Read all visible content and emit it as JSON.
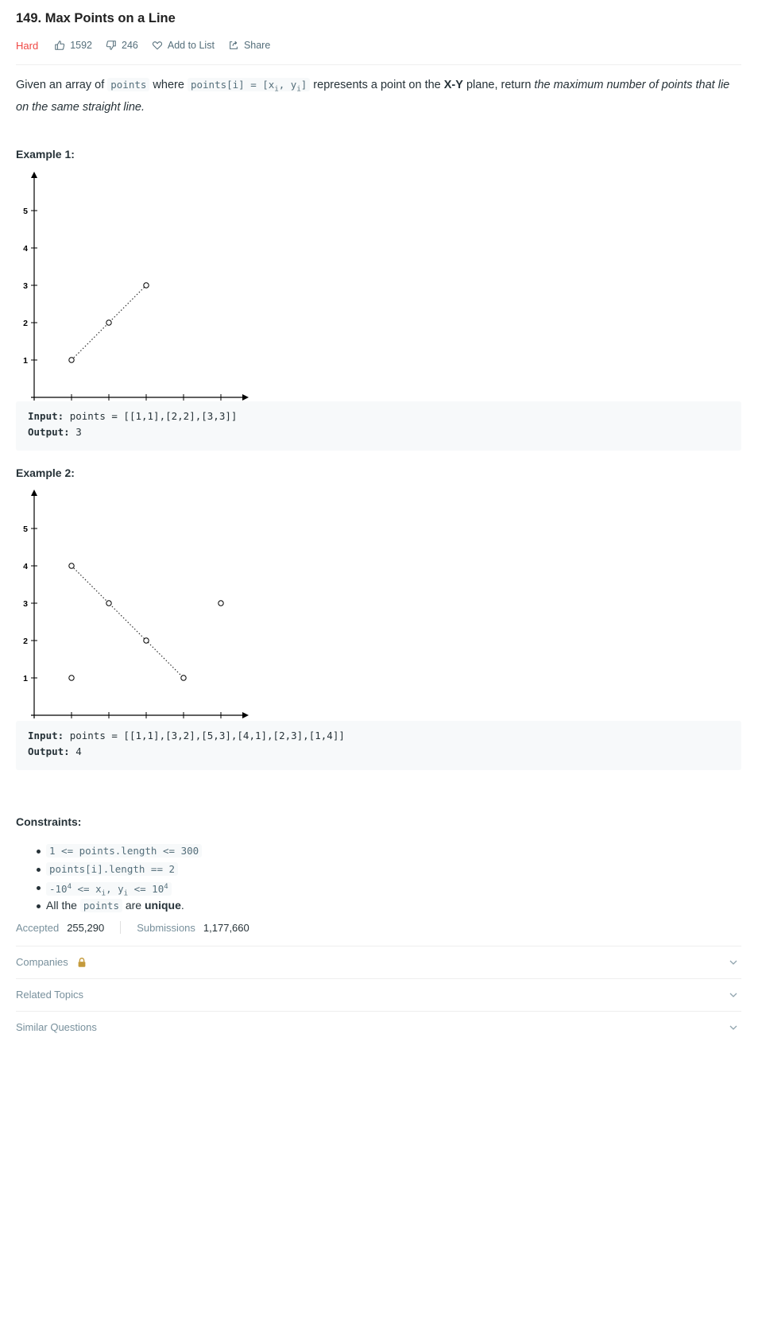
{
  "problem": {
    "title": "149. Max Points on a Line",
    "difficulty": "Hard",
    "likes": "1592",
    "dislikes": "246",
    "add_to_list_label": "Add to List",
    "share_label": "Share"
  },
  "description": {
    "p1": "Given an array of ",
    "code_points": "points",
    "p2": " where ",
    "code_points_i": "points[i] = [x",
    "sub_i": "i",
    "code_mid": ", y",
    "code_end": "]",
    "p3": " represents a point on the ",
    "xy_bold": "X-Y",
    "p4": " plane, return ",
    "italic": "the maximum number of points that lie on the same straight line",
    "p5": "."
  },
  "examples": [
    {
      "heading": "Example 1:",
      "input_label": "Input:",
      "input_value": "points = [[1,1],[2,2],[3,3]]",
      "output_label": "Output:",
      "output_value": "3",
      "chart_data": {
        "type": "scatter",
        "x_ticks": [
          "0",
          "1",
          "2",
          "3",
          "4",
          "5"
        ],
        "y_ticks": [
          "1",
          "2",
          "3",
          "4",
          "5"
        ],
        "xlim": [
          0,
          5
        ],
        "ylim": [
          0,
          5
        ],
        "points": [
          [
            1,
            1
          ],
          [
            2,
            2
          ],
          [
            3,
            3
          ]
        ],
        "line": [
          [
            1,
            1
          ],
          [
            3,
            3
          ]
        ],
        "grid": false
      }
    },
    {
      "heading": "Example 2:",
      "input_label": "Input:",
      "input_value": "points = [[1,1],[3,2],[5,3],[4,1],[2,3],[1,4]]",
      "output_label": "Output:",
      "output_value": "4",
      "chart_data": {
        "type": "scatter",
        "x_ticks": [
          "0",
          "1",
          "2",
          "3",
          "4",
          "5"
        ],
        "y_ticks": [
          "1",
          "2",
          "3",
          "4",
          "5"
        ],
        "xlim": [
          0,
          5
        ],
        "ylim": [
          0,
          5
        ],
        "points": [
          [
            1,
            4
          ],
          [
            2,
            3
          ],
          [
            3,
            2
          ],
          [
            4,
            1
          ],
          [
            1,
            1
          ],
          [
            5,
            3
          ]
        ],
        "line": [
          [
            1,
            4
          ],
          [
            4,
            1
          ]
        ],
        "grid": false
      }
    }
  ],
  "constraints": {
    "heading": "Constraints:",
    "c1": "1 <= points.length <= 300",
    "c2": "points[i].length == 2",
    "c3_a": "-10",
    "c3_b": "4",
    "c3_c": " <= x",
    "c3_d": "i",
    "c3_e": ", y",
    "c3_f": "i",
    "c3_g": " <= 10",
    "c3_h": "4",
    "c4_a": "All the ",
    "c4_code": "points",
    "c4_b": " are ",
    "c4_bold": "unique",
    "c4_c": "."
  },
  "stats": {
    "accepted_label": "Accepted",
    "accepted_value": "255,290",
    "submissions_label": "Submissions",
    "submissions_value": "1,177,660"
  },
  "accordions": [
    {
      "label": "Companies",
      "icon": "lock-icon"
    },
    {
      "label": "Related Topics"
    },
    {
      "label": "Similar Questions"
    }
  ],
  "colors": {
    "hard": "#ef4743",
    "lock": "#c49a3c",
    "code_bg": "#f7f9fa"
  }
}
